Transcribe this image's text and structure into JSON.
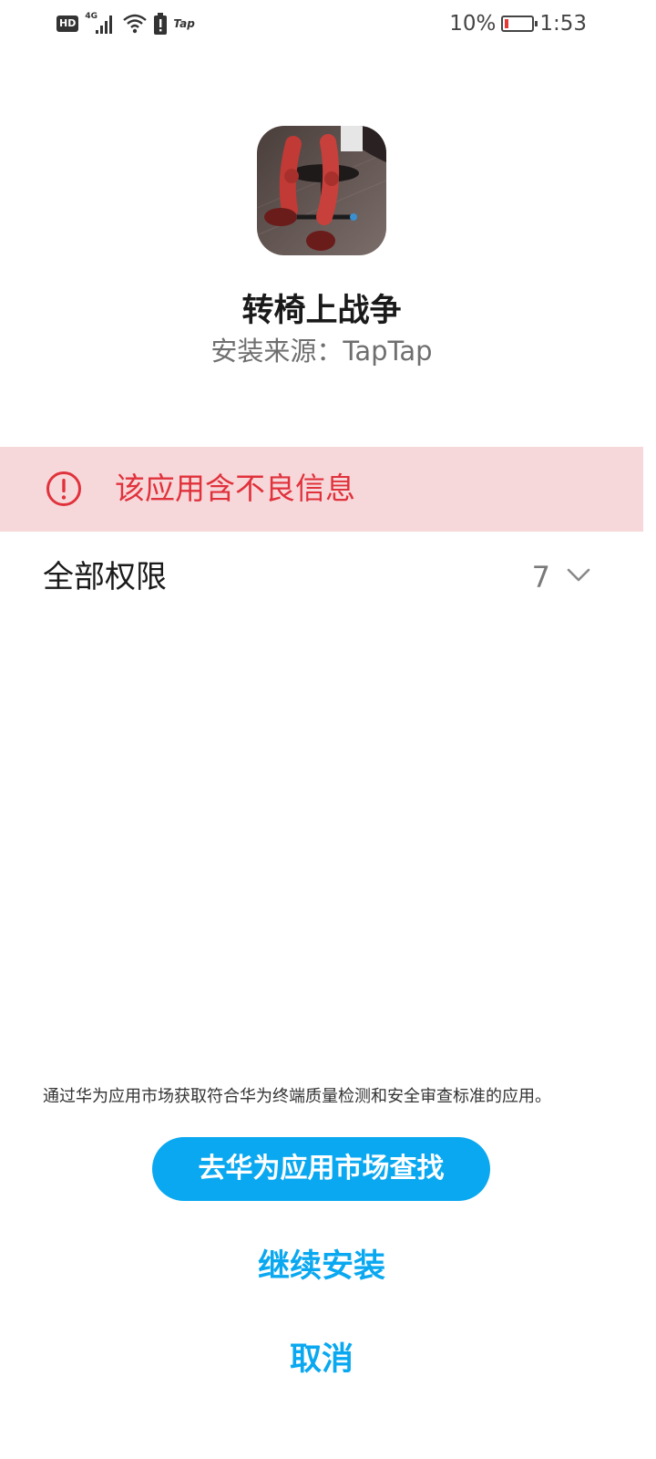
{
  "status_bar": {
    "hd_label": "HD",
    "network_label": "4G",
    "app_notification_label": "Tap",
    "battery_percent": "10%",
    "battery_level": 0.1,
    "time": "1:53"
  },
  "app": {
    "icon": "office-chair-game-icon",
    "name": "转椅上战争",
    "source": "安装来源：TapTap"
  },
  "warning": {
    "icon": "exclamation-circle-icon",
    "text": "该应用含不良信息",
    "color": "#e0323c",
    "background": "#f7d8da"
  },
  "permissions": {
    "title": "全部权限",
    "count": "7",
    "icon": "chevron-down-icon"
  },
  "footer": {
    "notice": "通过华为应用市场获取符合华为终端质量检测和安全审查标准的应用。",
    "primary_button": "去华为应用市场查找",
    "continue_button": "继续安装",
    "cancel_button": "取消",
    "accent_color": "#0aa8f0"
  }
}
